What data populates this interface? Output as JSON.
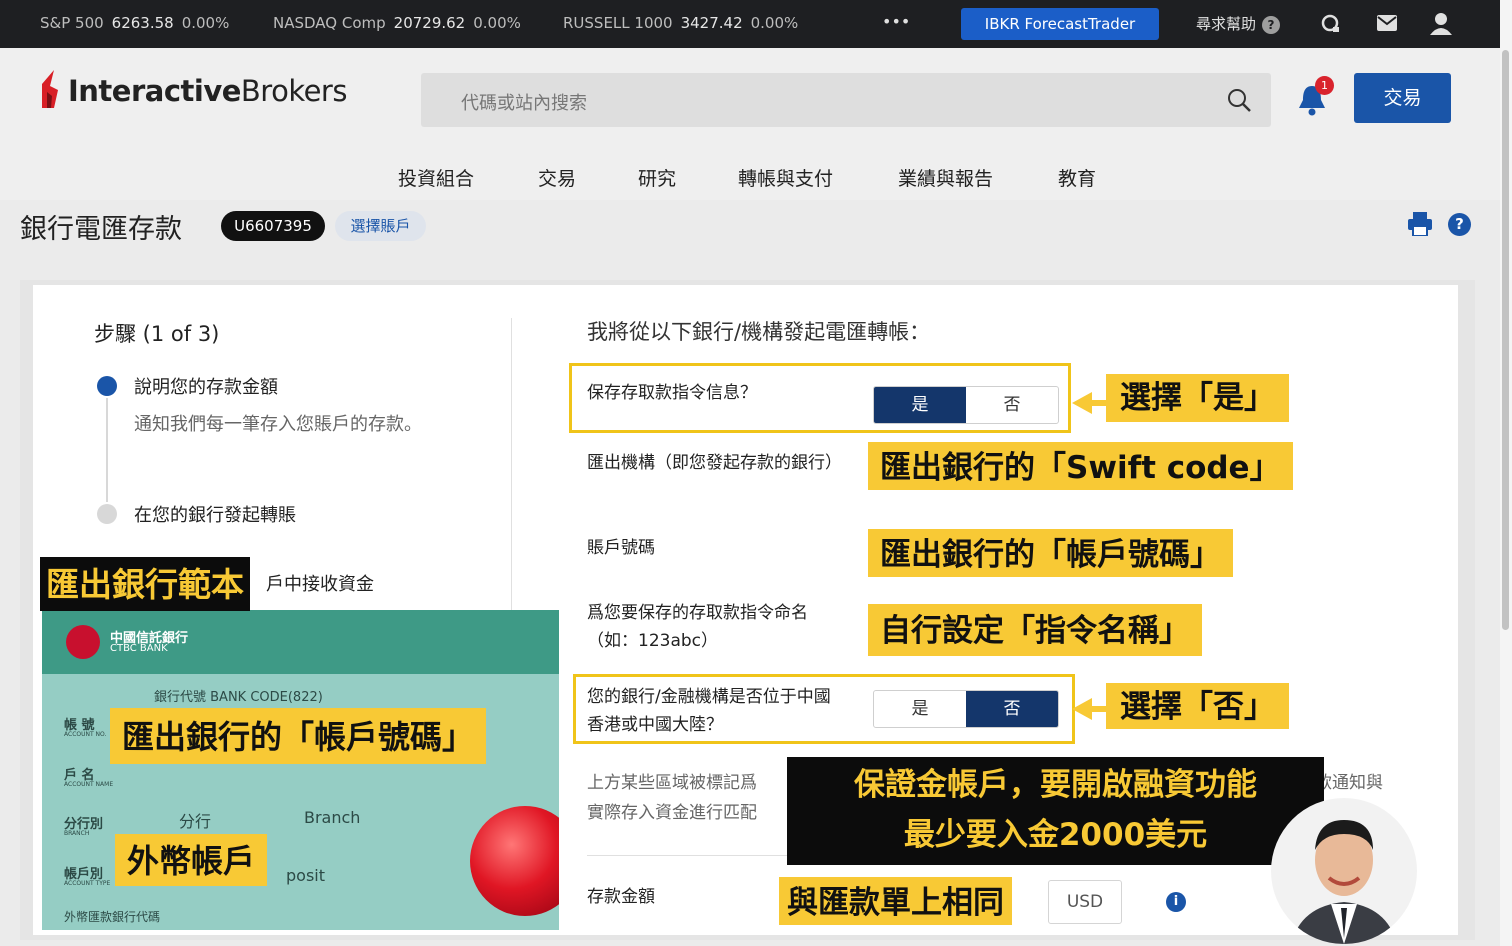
{
  "ticker": {
    "items": [
      {
        "name": "S&P 500",
        "value": "6263.58",
        "change": "0.00%"
      },
      {
        "name": "NASDAQ Comp",
        "value": "20729.62",
        "change": "0.00%"
      },
      {
        "name": "RUSSELL 1000",
        "value": "3427.42",
        "change": "0.00%"
      }
    ],
    "more": "•••",
    "forecast_button": "IBKR ForecastTrader",
    "help": "尋求幫助"
  },
  "header": {
    "logo_bold": "Interactive",
    "logo_regular": "Brokers",
    "search_placeholder": "代碼或站內搜索",
    "notification_count": "1",
    "trade_button": "交易",
    "nav": [
      "投資組合",
      "交易",
      "研究",
      "轉帳與支付",
      "業績與報告",
      "教育"
    ]
  },
  "page": {
    "title": "銀行電匯存款",
    "account_id": "U6607395",
    "select_account": "選擇賬戶"
  },
  "steps": {
    "title": "步驟 (1 of 3)",
    "step1_label": "說明您的存款金額",
    "step1_desc": "通知我們每一筆存入您賬戶的存款。",
    "step2_label": "在您的銀行發起轉賬",
    "step3_label_visible": "戶中接收資金"
  },
  "form": {
    "heading": "我將從以下銀行/機構發起電匯轉帳：",
    "save_label": "保存存取款指令信息？",
    "save_yes": "是",
    "save_no": "否",
    "institution_label": "匯出機構（即您發起存款的銀行）",
    "account_label": "賬戶號碼",
    "instruction_label": "爲您要保存的存取款指令命名（如：123abc）",
    "hk_label": "您的銀行/金融機構是否位于中國香港或中國大陸？",
    "hk_yes": "是",
    "hk_no": "否",
    "note_left": "上方某些區域被標記爲",
    "note_left2": "實際存入資金進行匹配",
    "note_right": "款通知與",
    "amount_label": "存款金額",
    "currency": "USD"
  },
  "annotations": {
    "choose_yes": "選擇「是」",
    "swift": "匯出銀行的「Swift code」",
    "account_no": "匯出銀行的「帳戶號碼」",
    "instruction_name": "自行設定「指令名稱」",
    "choose_no": "選擇「否」",
    "margin_line1": "保證金帳戶，要開啟融資功能",
    "margin_line2": "最少要入金2000美元",
    "same_as_slip": "與匯款單上相同",
    "template_title": "匯出銀行範本",
    "card_account_no": "匯出銀行的「帳戶號碼」",
    "foreign_account": "外幣帳戶"
  },
  "bank_card": {
    "bank_name_cn": "中國信託銀行",
    "bank_name_en": "CTBC BANK",
    "bank_code": "銀行代號 BANK CODE(822)",
    "account_label": "帳 號",
    "account_label_en": "ACCOUNT NO.",
    "name_label": "戶 名",
    "name_label_en": "ACCOUNT NAME",
    "branch_label": "分行別",
    "branch_label_en": "BRANCH",
    "branch_cn": "分行",
    "branch_en": "Branch",
    "type_label": "帳戶別",
    "type_label_en": "ACCOUNT TYPE",
    "type_value_partial": "posit",
    "footer": "外幣匯款銀行代碼"
  },
  "colors": {
    "ticker_bg": "#1e1f22",
    "brand_blue": "#1a55a8",
    "toggle_active": "#14366b",
    "highlight": "#f8c935",
    "logo_red": "#d81f26"
  }
}
